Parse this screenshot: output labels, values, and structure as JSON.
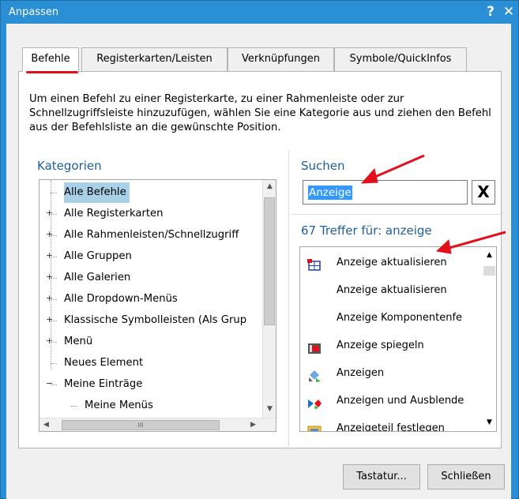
{
  "window": {
    "title": "Anpassen",
    "help": "?",
    "close": "✕"
  },
  "tabs": [
    {
      "label": "Befehle",
      "active": true
    },
    {
      "label": "Registerkarten/Leisten",
      "active": false
    },
    {
      "label": "Verknüpfungen",
      "active": false
    },
    {
      "label": "Symbole/QuickInfos",
      "active": false
    }
  ],
  "description": "Um einen Befehl zu einer Registerkarte, zu einer Rahmenleiste oder zur Schnellzugriffsleiste hinzuzufügen, wählen Sie eine Kategorie aus und ziehen den Befehl aus der Befehlsliste an die gewünschte Position.",
  "categories": {
    "title": "Kategorien",
    "items": [
      {
        "label": "Alle Befehle",
        "expandable": false,
        "selected": true
      },
      {
        "label": "Alle Registerkarten",
        "expandable": true
      },
      {
        "label": "Alle Rahmenleisten/Schnellzugriff",
        "expandable": true
      },
      {
        "label": "Alle Gruppen",
        "expandable": true
      },
      {
        "label": "Alle Galerien",
        "expandable": true
      },
      {
        "label": "Alle Dropdown-Menüs",
        "expandable": true
      },
      {
        "label": "Klassische Symbolleisten (Als Grup",
        "expandable": true
      },
      {
        "label": "Menü",
        "expandable": true
      },
      {
        "label": "Neues Element",
        "expandable": false
      },
      {
        "label": "Meine Einträge",
        "expandable": true,
        "expanded": true
      },
      {
        "label": "Meine Menüs",
        "expandable": false,
        "child": true
      }
    ],
    "hscroll_grip": "III"
  },
  "search": {
    "title": "Suchen",
    "value": "Anzeige",
    "clear": "X"
  },
  "results": {
    "title": "67 Treffer für: anzeige",
    "items": [
      {
        "label": "Anzeige aktualisieren",
        "icon": "refresh-display-icon"
      },
      {
        "label": "Anzeige aktualisieren",
        "icon": ""
      },
      {
        "label": "Anzeige Komponentenfe",
        "icon": ""
      },
      {
        "label": "Anzeige spiegeln",
        "icon": "mirror-display-icon"
      },
      {
        "label": "Anzeigen",
        "icon": "show-icon"
      },
      {
        "label": "Anzeigen und Ausblende",
        "icon": "show-hide-icon"
      },
      {
        "label": "Anzeigeteil festlegen",
        "icon": "display-part-icon"
      }
    ]
  },
  "buttons": {
    "keyboard": "Tastatur...",
    "close": "Schließen"
  },
  "annotation_color": "#e2101c",
  "accent": "#2b8fd6"
}
